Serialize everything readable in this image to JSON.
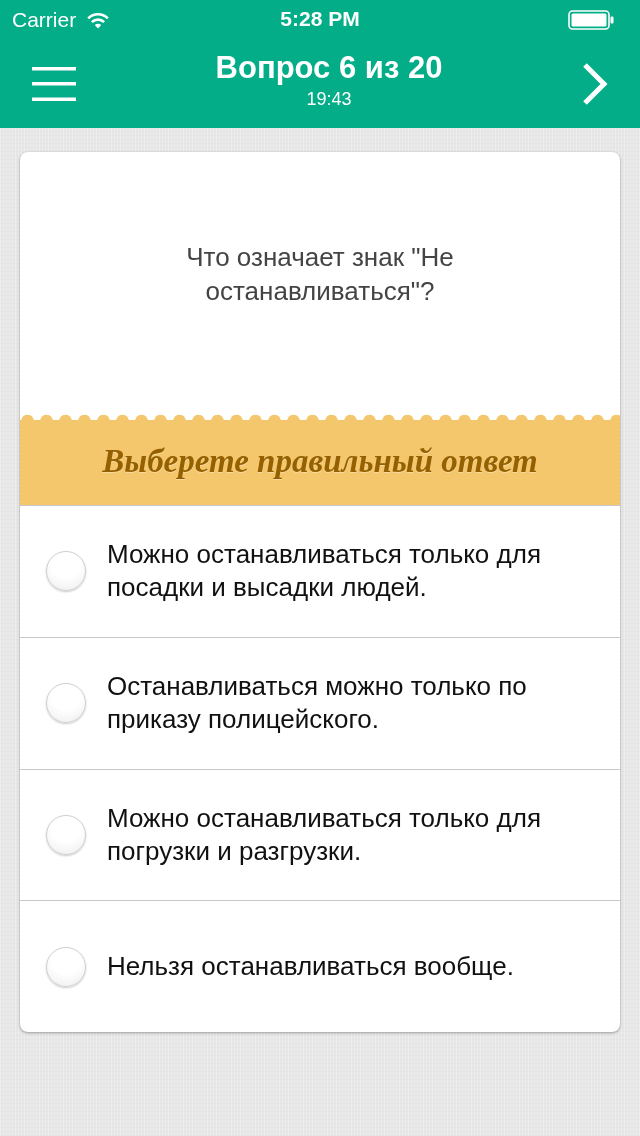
{
  "status_bar": {
    "carrier": "Carrier",
    "time": "5:28 PM"
  },
  "nav": {
    "title": "Вопрос 6 из 20",
    "timer": "19:43"
  },
  "question": {
    "text": "Что означает знак \"Не останавливаться\"?"
  },
  "banner": {
    "text": "Выберете правильный ответ"
  },
  "answers": [
    {
      "text": "Можно останавливаться только для посадки и высадки людей.",
      "selected": false
    },
    {
      "text": "Останавливаться можно только по приказу полицейского.",
      "selected": false
    },
    {
      "text": "Можно останавливаться только для погрузки и разгрузки.",
      "selected": false
    },
    {
      "text": "Нельзя останавливаться вообще.",
      "selected": false
    }
  ]
}
